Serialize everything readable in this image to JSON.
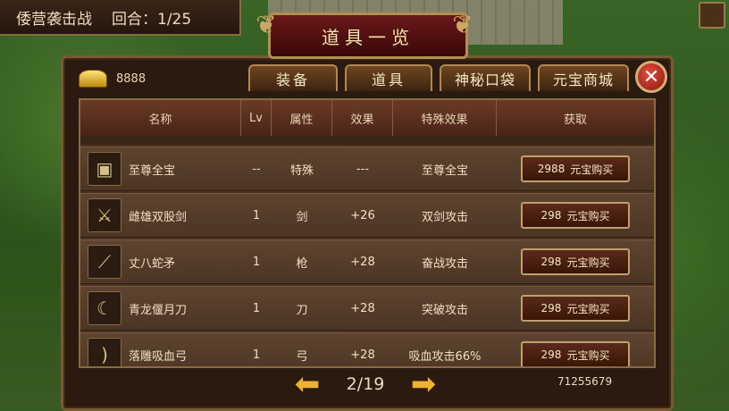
{
  "topbar": {
    "stage": "倭营袭击战",
    "round_label": "回合：1/25"
  },
  "title": "道具一览",
  "currency": {
    "icon": "gold-ingot-icon",
    "amount": "8888"
  },
  "tabs": [
    {
      "label": "装备"
    },
    {
      "label": "道具"
    },
    {
      "label": "神秘口袋"
    },
    {
      "label": "元宝商城"
    }
  ],
  "close_icon": "✕",
  "columns": [
    "名称",
    "Lv",
    "属性",
    "效果",
    "特殊效果",
    "获取"
  ],
  "items": [
    {
      "icon": "treasure-chest-icon",
      "name": "至尊全宝",
      "lv": "--",
      "attr": "特殊",
      "effect": "---",
      "special": "至尊全宝",
      "price": "2988",
      "buy_label": "元宝购买"
    },
    {
      "icon": "twin-swords-icon",
      "name": "雌雄双股剑",
      "lv": "1",
      "attr": "剑",
      "effect": "+26",
      "special": "双剑攻击",
      "price": "298",
      "buy_label": "元宝购买"
    },
    {
      "icon": "spear-icon",
      "name": "丈八蛇矛",
      "lv": "1",
      "attr": "枪",
      "effect": "+28",
      "special": "奋战攻击",
      "price": "298",
      "buy_label": "元宝购买"
    },
    {
      "icon": "glaive-icon",
      "name": "青龙偃月刀",
      "lv": "1",
      "attr": "刀",
      "effect": "+28",
      "special": "突破攻击",
      "price": "298",
      "buy_label": "元宝购买"
    },
    {
      "icon": "bow-icon",
      "name": "落雕吸血弓",
      "lv": "1",
      "attr": "弓",
      "effect": "+28",
      "special": "吸血攻击66%",
      "price": "298",
      "buy_label": "元宝购买"
    }
  ],
  "pager": {
    "page": "2/19"
  },
  "user_id": "71255679",
  "colors": {
    "accent_gold": "#f0b030",
    "panel": "#2a1a10",
    "close_red": "#c0281c"
  }
}
